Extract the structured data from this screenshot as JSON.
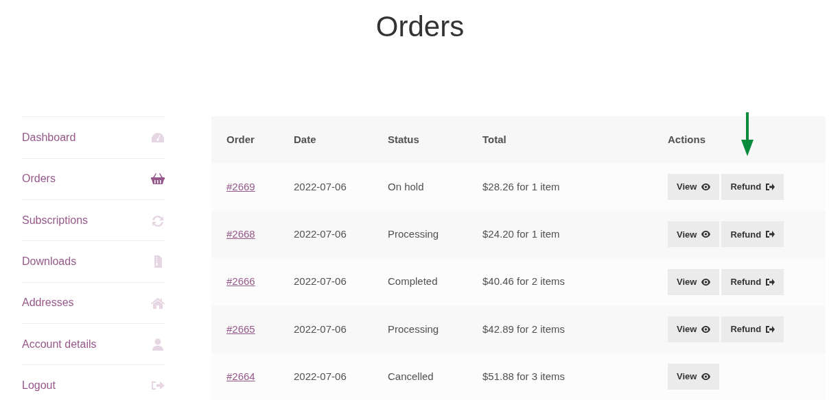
{
  "page_title": "Orders",
  "sidebar": {
    "items": [
      {
        "label": "Dashboard",
        "selected": false
      },
      {
        "label": "Orders",
        "selected": true
      },
      {
        "label": "Subscriptions",
        "selected": false
      },
      {
        "label": "Downloads",
        "selected": false
      },
      {
        "label": "Addresses",
        "selected": false
      },
      {
        "label": "Account details",
        "selected": false
      },
      {
        "label": "Logout",
        "selected": false
      }
    ]
  },
  "table": {
    "columns": [
      "Order",
      "Date",
      "Status",
      "Total",
      "Actions"
    ],
    "rows": [
      {
        "order": "#2669",
        "date": "2022-07-06",
        "status": "On hold",
        "total": "$28.26 for 1 item",
        "actions": [
          {
            "kind": "view",
            "label": "View"
          },
          {
            "kind": "refund",
            "label": "Refund"
          }
        ]
      },
      {
        "order": "#2668",
        "date": "2022-07-06",
        "status": "Processing",
        "total": "$24.20 for 1 item",
        "actions": [
          {
            "kind": "view",
            "label": "View"
          },
          {
            "kind": "refund",
            "label": "Refund"
          }
        ]
      },
      {
        "order": "#2666",
        "date": "2022-07-06",
        "status": "Completed",
        "total": "$40.46 for 2 items",
        "actions": [
          {
            "kind": "view",
            "label": "View"
          },
          {
            "kind": "refund",
            "label": "Refund"
          }
        ]
      },
      {
        "order": "#2665",
        "date": "2022-07-06",
        "status": "Processing",
        "total": "$42.89 for 2 items",
        "actions": [
          {
            "kind": "view",
            "label": "View"
          },
          {
            "kind": "refund",
            "label": "Refund"
          }
        ]
      },
      {
        "order": "#2664",
        "date": "2022-07-06",
        "status": "Cancelled",
        "total": "$51.88 for 3 items",
        "actions": [
          {
            "kind": "view",
            "label": "View"
          }
        ]
      }
    ]
  }
}
